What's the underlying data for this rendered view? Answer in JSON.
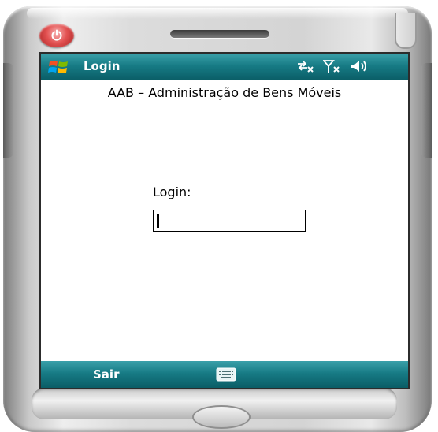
{
  "title_bar": {
    "title": "Login",
    "status_icons": [
      "connectivity-icon",
      "signal-off-icon",
      "volume-icon"
    ]
  },
  "app": {
    "heading": "AAB – Administração de Bens Móveis"
  },
  "form": {
    "login_label": "Login:",
    "login_value": ""
  },
  "softkeys": {
    "left_label": "Sair",
    "center_icon": "keyboard-icon"
  },
  "colors": {
    "bar_teal": "#177b85",
    "power_red": "#e35252"
  }
}
